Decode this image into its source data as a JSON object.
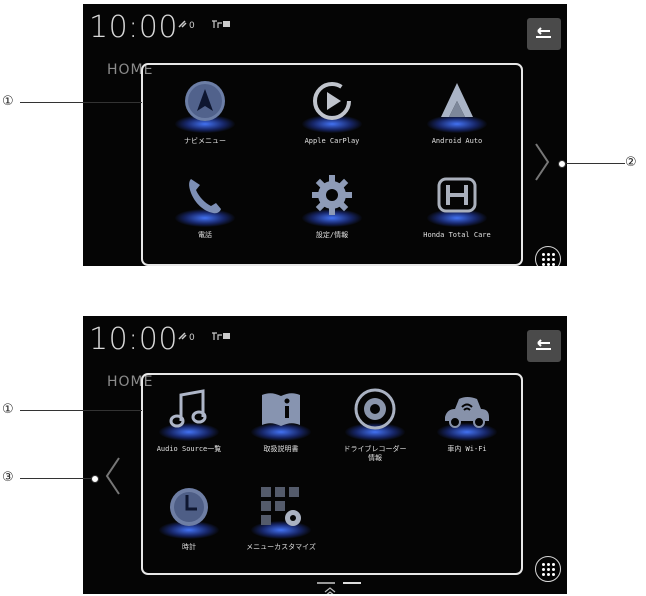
{
  "screen1": {
    "clock": "10:00",
    "home_label": "HOME",
    "apps": [
      {
        "label": "ナビメニュー",
        "icon": "navi-icon"
      },
      {
        "label": "Apple CarPlay",
        "icon": "apple-carplay-icon"
      },
      {
        "label": "Android Auto",
        "icon": "android-auto-icon"
      },
      {
        "label": "電話",
        "icon": "phone-icon"
      },
      {
        "label": "設定/情報",
        "icon": "settings-icon"
      },
      {
        "label": "Honda Total Care",
        "icon": "honda-logo-icon"
      }
    ]
  },
  "screen2": {
    "clock": "10:00",
    "home_label": "HOME",
    "apps": [
      {
        "label": "Audio Source一覧",
        "icon": "music-note-icon"
      },
      {
        "label": "取扱説明書",
        "icon": "manual-icon"
      },
      {
        "label": "ドライブレコーダー\n情報",
        "icon": "drive-recorder-icon"
      },
      {
        "label": "車内 Wi-Fi",
        "icon": "car-wifi-icon"
      },
      {
        "label": "時計",
        "icon": "clock-icon"
      },
      {
        "label": "メニューカスタマイズ",
        "icon": "menu-customize-icon"
      }
    ]
  },
  "callouts": {
    "c1": "①",
    "c2": "②",
    "c3": "③",
    "c1b": "①"
  },
  "colors": {
    "glow": "#4677ff",
    "background": "#050505",
    "frame": "#e8e8e8"
  }
}
